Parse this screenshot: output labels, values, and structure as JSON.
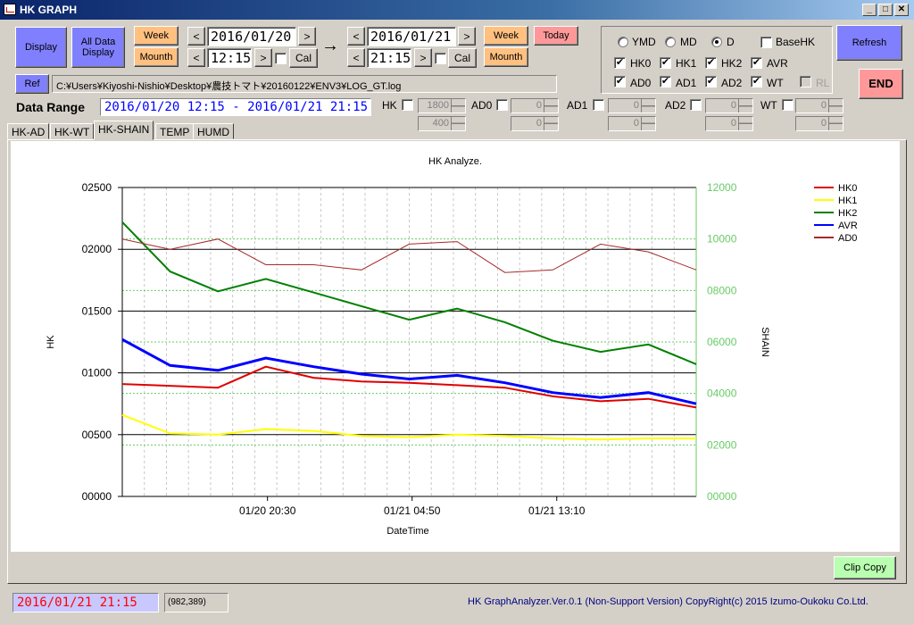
{
  "window": {
    "title": "HK GRAPH",
    "minimize": "_",
    "maximize": "□",
    "close": "✕"
  },
  "toolbar": {
    "display": "Display",
    "all_data_display": "All Data Display",
    "week_start": "Week",
    "mounth_start": "Mounth",
    "prev": "<",
    "next": ">",
    "start_date": "2016/01/20",
    "start_time": "12:15",
    "cal": "Cal",
    "to_arrow": "→",
    "end_date": "2016/01/21",
    "end_time": "21:15",
    "week_end": "Week",
    "mounth_end": "Mounth",
    "today": "Today",
    "refresh": "Refresh",
    "end": "END",
    "ref": "Ref",
    "path": "C:¥Users¥Kiyoshi-Nishio¥Desktop¥農技トマト¥20160122¥ENV3¥LOG_GT.log"
  },
  "options": {
    "ymd": "YMD",
    "md": "MD",
    "d": "D",
    "basehk": "BaseHK",
    "hk0": "HK0",
    "hk1": "HK1",
    "hk2": "HK2",
    "avr": "AVR",
    "ad0": "AD0",
    "ad1": "AD1",
    "ad2": "AD2",
    "wt": "WT",
    "rl": "RL"
  },
  "range": {
    "label": "Data Range",
    "value": "2016/01/20 12:15 - 2016/01/21 21:15",
    "hk": "HK",
    "ad0": "AD0",
    "ad1": "AD1",
    "ad2": "AD2",
    "wt": "WT",
    "hk_max": "1800",
    "hk_min": "400",
    "ad0_max": "0",
    "ad0_min": "0",
    "ad1_max": "0",
    "ad1_min": "0",
    "ad2_max": "0",
    "ad2_min": "0",
    "wt_max": "0",
    "wt_min": "0"
  },
  "tabs": [
    "HK-AD",
    "HK-WT",
    "HK-SHAIN",
    "TEMP",
    "HUMD"
  ],
  "chart_data": {
    "type": "line",
    "title": "HK Analyze.",
    "xlabel": "DateTime",
    "ylabel": "HK",
    "y2label": "SHAIN",
    "ylim": [
      0,
      2500
    ],
    "y2lim": [
      0,
      12000
    ],
    "yticks": [
      "00000",
      "00500",
      "01000",
      "01500",
      "02000",
      "02500"
    ],
    "y2ticks": [
      "00000",
      "02000",
      "04000",
      "06000",
      "08000",
      "10000",
      "12000"
    ],
    "xticks": [
      "01/20 20:30",
      "01/21 04:50",
      "01/21 13:10"
    ],
    "x": [
      "01/20 12:15",
      "01/20 15:00",
      "01/20 17:45",
      "01/20 20:30",
      "01/20 23:15",
      "01/21 02:05",
      "01/21 04:50",
      "01/21 07:35",
      "01/21 10:20",
      "01/21 13:10",
      "01/21 15:55",
      "01/21 18:40",
      "01/21 21:15"
    ],
    "series": [
      {
        "name": "HK0",
        "color": "#e00000",
        "axis": "left",
        "values": [
          910,
          895,
          880,
          1050,
          960,
          930,
          920,
          900,
          880,
          810,
          770,
          790,
          720
        ]
      },
      {
        "name": "HK1",
        "color": "#ffff00",
        "axis": "left",
        "values": [
          660,
          510,
          500,
          545,
          530,
          490,
          480,
          500,
          490,
          470,
          460,
          470,
          470
        ]
      },
      {
        "name": "HK2",
        "color": "#008000",
        "axis": "left",
        "values": [
          2220,
          1820,
          1660,
          1760,
          1650,
          1540,
          1430,
          1520,
          1410,
          1260,
          1170,
          1230,
          1070
        ]
      },
      {
        "name": "AVR",
        "color": "#0000ff",
        "axis": "left",
        "values": [
          1270,
          1060,
          1020,
          1120,
          1050,
          990,
          950,
          980,
          920,
          840,
          800,
          840,
          750
        ]
      },
      {
        "name": "AD0",
        "color": "#a52a2a",
        "axis": "right",
        "values": [
          10000,
          9600,
          10000,
          9000,
          9000,
          8800,
          9800,
          9900,
          8700,
          8800,
          9800,
          9500,
          8800
        ]
      }
    ],
    "legend_position": "top-right"
  },
  "buttons": {
    "clip_copy": "Clip Copy"
  },
  "status": {
    "datetime": "2016/01/21 21:15",
    "coords": "(982,389)",
    "copyright": "HK GraphAnalyzer.Ver.0.1 (Non-Support Version) CopyRight(c) 2015 Izumo-Oukoku Co.Ltd."
  }
}
